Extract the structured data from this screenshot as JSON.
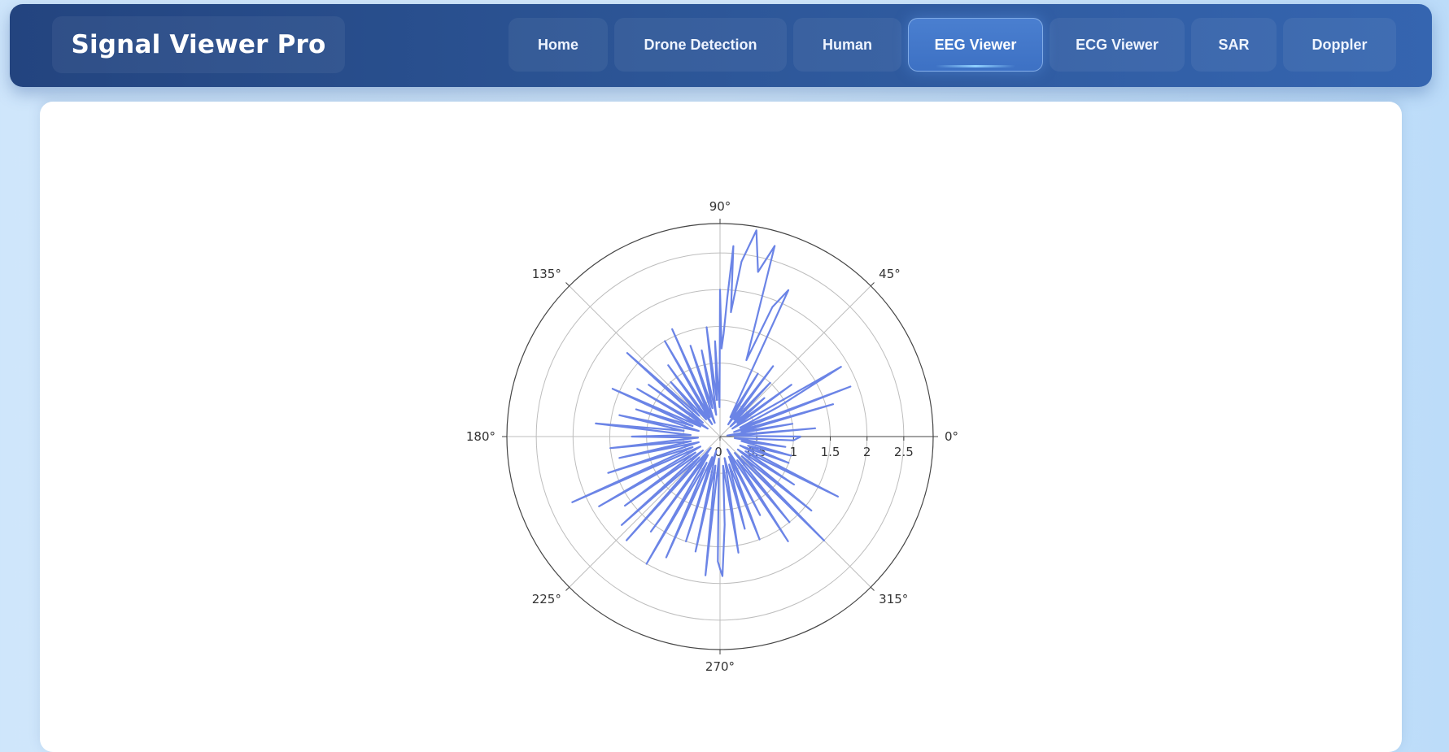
{
  "app": {
    "title": "Signal Viewer Pro"
  },
  "nav": {
    "items": [
      {
        "label": "Home",
        "active": false
      },
      {
        "label": "Drone Detection",
        "active": false
      },
      {
        "label": "Human",
        "active": false
      },
      {
        "label": "EEG Viewer",
        "active": true
      },
      {
        "label": "ECG Viewer",
        "active": false
      },
      {
        "label": "SAR",
        "active": false
      },
      {
        "label": "Doppler",
        "active": false
      }
    ]
  },
  "chart_data": {
    "type": "line",
    "subtype": "polar",
    "title": "",
    "angular_ticks": [
      "0°",
      "45°",
      "90°",
      "135°",
      "180°",
      "225°",
      "270°",
      "315°"
    ],
    "radial_ticks": [
      "0",
      "0.5",
      "1",
      "1.5",
      "2",
      "2.5"
    ],
    "radial_range": [
      0,
      2.9
    ],
    "grid": true,
    "legend": "none",
    "color": "#6b84e6",
    "series": [
      {
        "theta": [
          0,
          3,
          5,
          8,
          10,
          13,
          16,
          18,
          21,
          24,
          27,
          30,
          33,
          36,
          38,
          41,
          44,
          47,
          50,
          53,
          56,
          59,
          62,
          65,
          68,
          71,
          74,
          77,
          80,
          83,
          85,
          86,
          87,
          88,
          89,
          90,
          91,
          93,
          95,
          97,
          100,
          102,
          105,
          108,
          111,
          114,
          117,
          120,
          123,
          126,
          129,
          132,
          135,
          138,
          141,
          144,
          147,
          150,
          153,
          156,
          159,
          162,
          165,
          168,
          171,
          174,
          177,
          180,
          183,
          186,
          189,
          192,
          195,
          198,
          201,
          204,
          207,
          210,
          213,
          216,
          219,
          222,
          225,
          228,
          231,
          234,
          237,
          240,
          243,
          246,
          249,
          252,
          255,
          258,
          261,
          264,
          267,
          269,
          270,
          271,
          273,
          276,
          279,
          282,
          285,
          288,
          291,
          294,
          297,
          300,
          303,
          306,
          309,
          312,
          315,
          318,
          321,
          324,
          327,
          330,
          333,
          336,
          339,
          342,
          345,
          348,
          351,
          354,
          357,
          360
        ],
        "r": [
          1.1,
          0.2,
          1.3,
          0.1,
          1.0,
          0.3,
          1.6,
          0.2,
          1.9,
          0.3,
          0.9,
          1.9,
          0.2,
          1.2,
          0.3,
          0.8,
          0.2,
          1.0,
          0.3,
          1.2,
          0.2,
          1.0,
          0.3,
          2.2,
          1.9,
          1.1,
          2.7,
          2.3,
          2.85,
          2.4,
          1.7,
          2.6,
          1.9,
          1.4,
          1.2,
          2.0,
          0.4,
          1.3,
          0.5,
          1.5,
          0.3,
          1.2,
          0.4,
          1.3,
          0.2,
          1.6,
          0.3,
          1.5,
          0.2,
          1.2,
          0.3,
          1.0,
          0.4,
          1.7,
          0.3,
          1.2,
          0.2,
          1.3,
          0.3,
          1.6,
          0.4,
          1.2,
          0.3,
          1.4,
          0.5,
          1.7,
          0.4,
          1.2,
          0.3,
          1.5,
          0.4,
          1.4,
          0.3,
          1.6,
          0.4,
          2.2,
          0.3,
          1.9,
          0.4,
          1.6,
          0.3,
          1.8,
          0.4,
          1.9,
          0.2,
          1.6,
          0.3,
          2.0,
          0.4,
          1.8,
          0.3,
          1.5,
          0.2,
          1.6,
          0.4,
          1.9,
          0.3,
          1.7,
          1.8,
          1.9,
          1.2,
          0.4,
          1.6,
          0.3,
          1.3,
          0.4,
          1.5,
          0.3,
          1.2,
          0.2,
          1.7,
          0.4,
          1.5,
          0.3,
          2.0,
          0.4,
          1.6,
          0.3,
          1.2,
          0.4,
          1.8,
          0.3,
          1.0,
          0.4,
          1.0,
          0.3,
          0.9,
          0.2,
          1.0,
          1.1
        ]
      }
    ]
  }
}
